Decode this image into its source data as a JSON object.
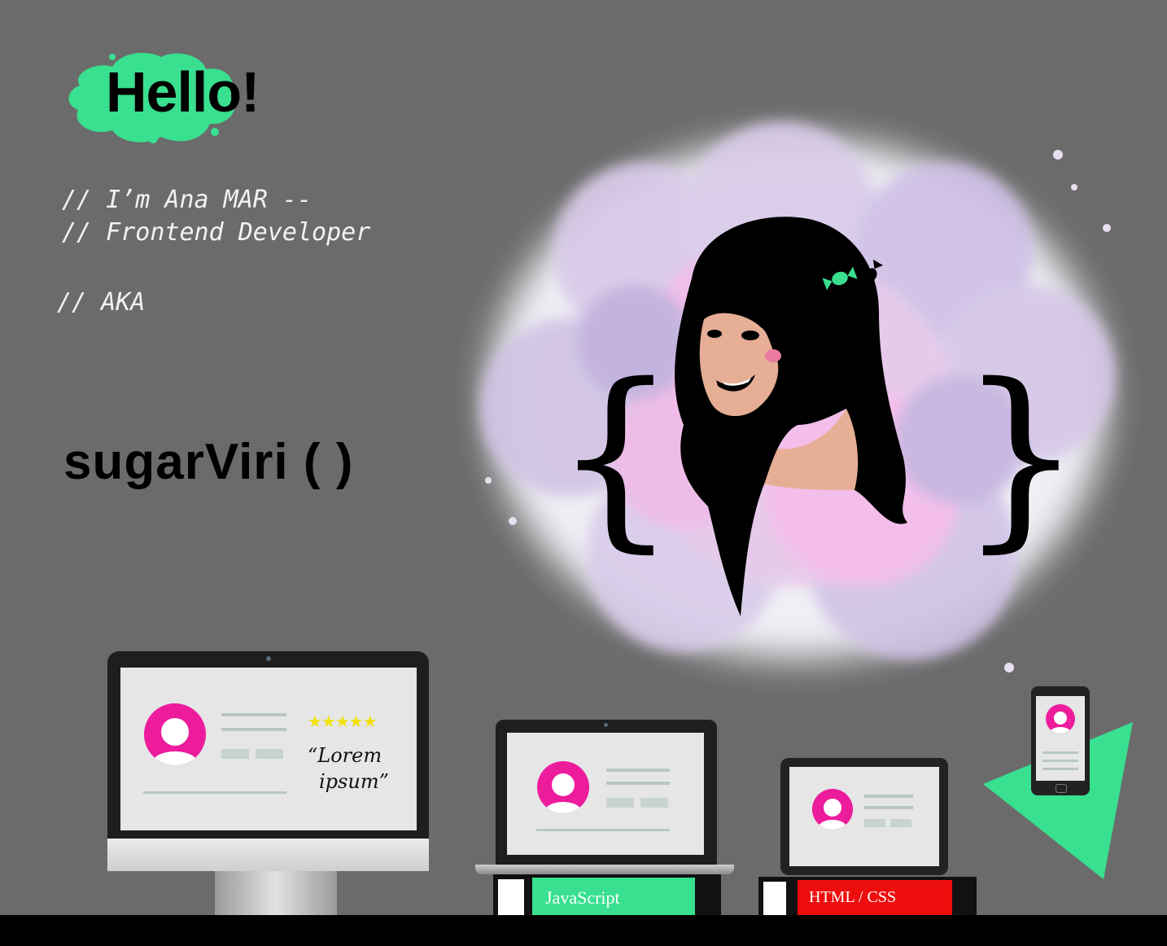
{
  "greeting": "Hello!",
  "intro": {
    "line1": "// I’m Ana MAR --",
    "line2": "// Frontend Developer",
    "aka": "// AKA"
  },
  "alias": "sugarViri ( )",
  "braces": {
    "left": "{",
    "right": "}"
  },
  "monitor": {
    "quote_line1": "“Lorem",
    "quote_line2": "ipsum”",
    "rating_stars": 5
  },
  "books": {
    "javascript": "JavaScript",
    "html_css": "HTML / CSS"
  },
  "colors": {
    "background": "#6b6b6b",
    "accent_green": "#38e08f",
    "accent_pink": "#ec1c9c",
    "accent_red": "#ee0d0d",
    "star_yellow": "#f3e10f"
  }
}
